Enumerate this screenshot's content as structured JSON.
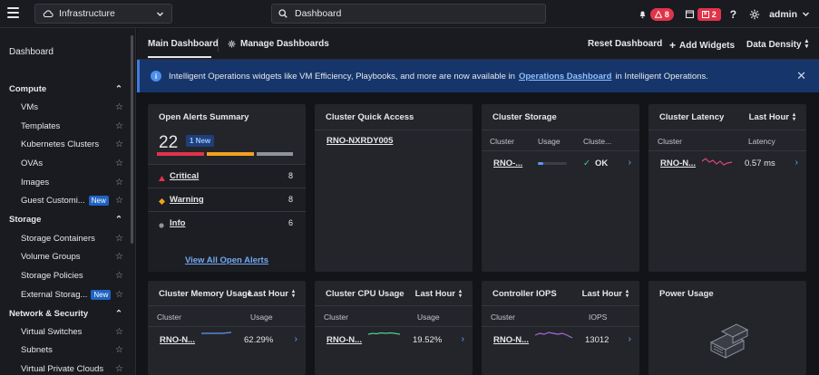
{
  "topbar": {
    "app_name": "Infrastructure",
    "search_value": "Dashboard",
    "alerts_count": "8",
    "tasks_count": "2",
    "user": "admin"
  },
  "sidebar": {
    "dashboard": "Dashboard",
    "compute": {
      "title": "Compute",
      "items": [
        "VMs",
        "Templates",
        "Kubernetes Clusters",
        "OVAs",
        "Images",
        "Guest Customi..."
      ],
      "new_label": "New"
    },
    "storage": {
      "title": "Storage",
      "items": [
        "Storage Containers",
        "Volume Groups",
        "Storage Policies",
        "External Storag..."
      ],
      "new_label": "New"
    },
    "network": {
      "title": "Network & Security",
      "items": [
        "Virtual Switches",
        "Subnets",
        "Virtual Private Clouds"
      ]
    }
  },
  "header": {
    "tab_main": "Main Dashboard",
    "tab_manage": "Manage Dashboards",
    "reset": "Reset Dashboard",
    "add_widgets": "Add Widgets",
    "density": "Data Density"
  },
  "banner": {
    "text_before": "Intelligent Operations widgets like VM Efficiency, Playbooks, and more are now available in",
    "link": "Operations Dashboard",
    "text_after": "in Intelligent Operations."
  },
  "cards": {
    "alerts": {
      "title": "Open Alerts Summary",
      "count": "22",
      "new_badge": "1 New",
      "rows": [
        {
          "label": "Critical",
          "count": "8"
        },
        {
          "label": "Warning",
          "count": "8"
        },
        {
          "label": "Info",
          "count": "6"
        }
      ],
      "footer": "View All Open Alerts",
      "bar_fractions": {
        "critical": 0.36,
        "warning": 0.36,
        "info": 0.28
      },
      "colors": {
        "critical": "#e2334a",
        "warning": "#f2a21c",
        "info": "#8f939b"
      }
    },
    "quick_access": {
      "title": "Cluster Quick Access",
      "cluster": "RNO-NXRDY005"
    },
    "storage": {
      "title": "Cluster Storage",
      "cols": [
        "Cluster",
        "Usage",
        "Cluste..."
      ],
      "row": {
        "cluster": "RNO-...",
        "status": "OK"
      }
    },
    "latency": {
      "title": "Cluster Latency",
      "period": "Last Hour",
      "cols": [
        "Cluster",
        "Latency"
      ],
      "row": {
        "cluster": "RNO-N...",
        "value": "0.57 ms"
      }
    },
    "memory": {
      "title": "Cluster Memory Usage",
      "period": "Last Hour",
      "cols": [
        "Cluster",
        "Usage"
      ],
      "row": {
        "cluster": "RNO-N...",
        "value": "62.29%"
      }
    },
    "cpu": {
      "title": "Cluster CPU Usage",
      "period": "Last Hour",
      "cols": [
        "Cluster",
        "Usage"
      ],
      "row": {
        "cluster": "RNO-N...",
        "value": "19.52%"
      }
    },
    "iops": {
      "title": "Controller IOPS",
      "period": "Last Hour",
      "cols": [
        "Cluster",
        "IOPS"
      ],
      "row": {
        "cluster": "RNO-N...",
        "value": "13012"
      }
    },
    "power": {
      "title": "Power Usage"
    }
  },
  "colors": {
    "accent": "#3f7bdc",
    "link": "#72aaf3",
    "latency_spark": "#e0457b",
    "cpu_spark": "#4cd38a",
    "iops_spark": "#a56bdb",
    "memory_spark": "#5b9bf0"
  }
}
